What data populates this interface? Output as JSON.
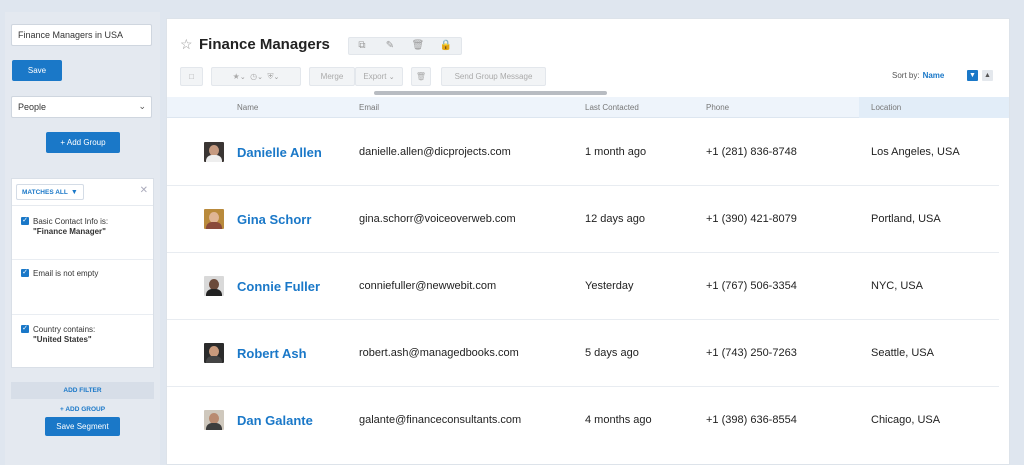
{
  "sidebar": {
    "search_value": "Finance Managers in USA",
    "save_label": "Save",
    "type_select": "People",
    "add_group_label": "+ Add Group",
    "filter": {
      "match_label": "MATCHES ALL",
      "conditions": [
        {
          "prefix": "Basic Contact Info is:",
          "value": "\"Finance Manager\""
        },
        {
          "prefix": "Email is not empty",
          "value": ""
        },
        {
          "prefix": "Country contains:",
          "value": "\"United States\""
        }
      ]
    },
    "add_filter_label": "ADD FILTER",
    "add_group_link": "+ ADD GROUP",
    "save_segment_label": "Save Segment"
  },
  "header": {
    "title": "Finance Managers",
    "toolbar": {
      "merge": "Merge",
      "export": "Export",
      "send_group_message": "Send Group Message"
    },
    "sort_by_label": "Sort by:",
    "sort_by_value": "Name"
  },
  "table": {
    "columns": [
      "Name",
      "Email",
      "Last Contacted",
      "Phone",
      "Location"
    ],
    "rows": [
      {
        "name": "Danielle Allen",
        "email": "danielle.allen@dicprojects.com",
        "last_contacted": "1 month ago",
        "phone": "+1 (281) 836-8748",
        "location": "Los Angeles, USA"
      },
      {
        "name": "Gina Schorr",
        "email": "gina.schorr@voiceoverweb.com",
        "last_contacted": "12 days ago",
        "phone": "+1 (390) 421-8079",
        "location": "Portland, USA"
      },
      {
        "name": "Connie Fuller",
        "email": "conniefuller@newwebit.com",
        "last_contacted": "Yesterday",
        "phone": "+1 (767) 506-3354",
        "location": "NYC, USA"
      },
      {
        "name": "Robert Ash",
        "email": "robert.ash@managedbooks.com",
        "last_contacted": "5 days ago",
        "phone": "+1 (743) 250-7263",
        "location": "Seattle, USA"
      },
      {
        "name": "Dan Galante",
        "email": "galante@financeconsultants.com",
        "last_contacted": "4 months ago",
        "phone": "+1 (398) 636-8554",
        "location": "Chicago, USA"
      }
    ]
  },
  "colors": {
    "accent": "#1a78c8",
    "background": "#dfe6ef"
  }
}
